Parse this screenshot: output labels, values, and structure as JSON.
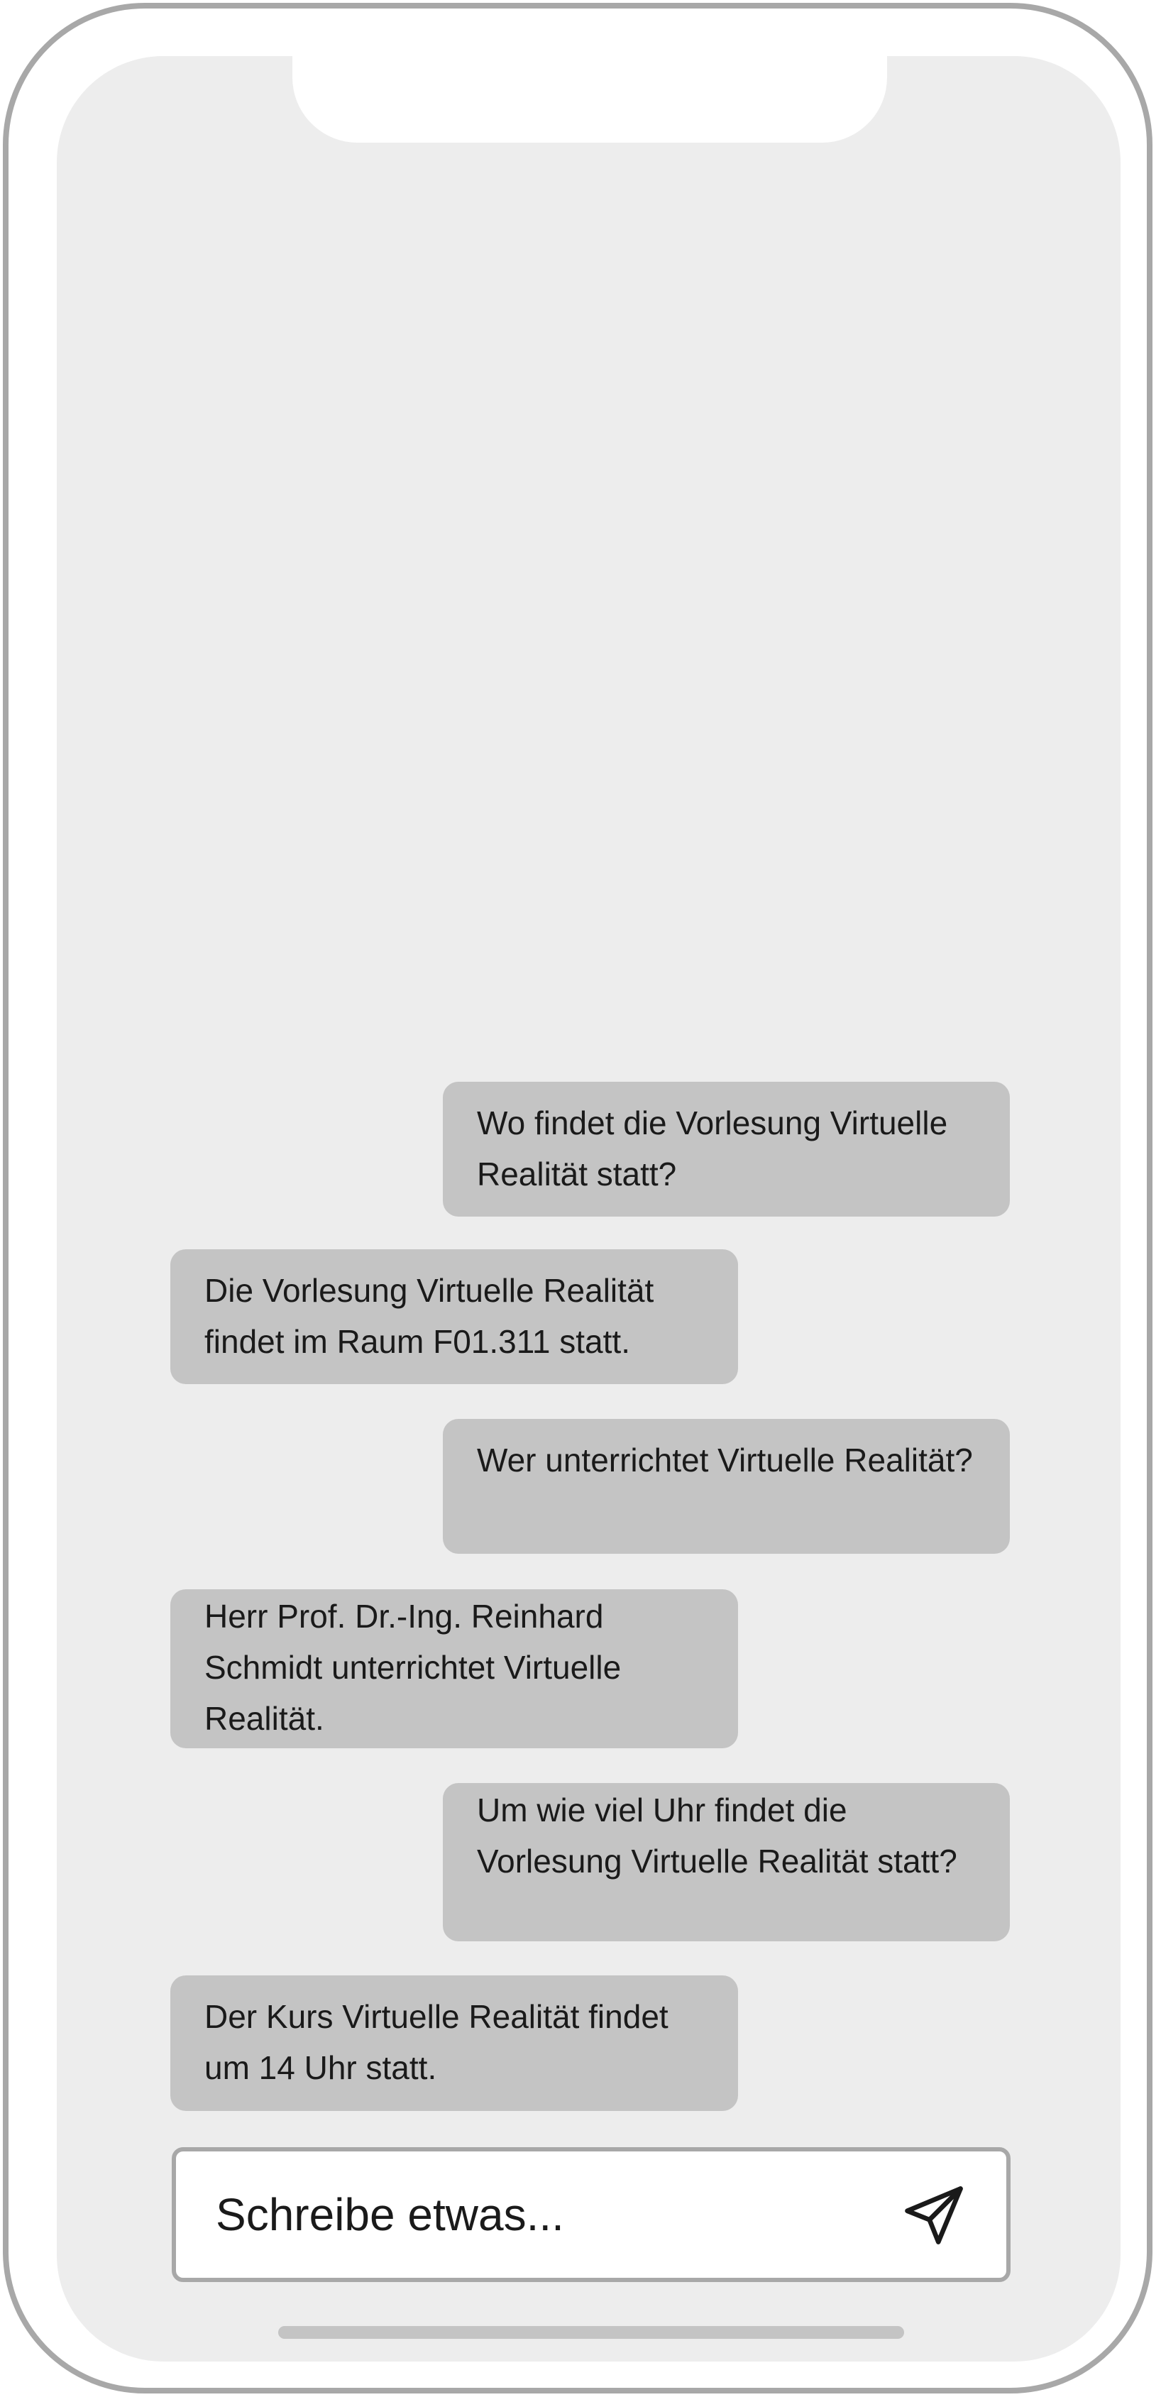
{
  "chat": {
    "messages": [
      {
        "sender": "user",
        "text": "Wo findet die Vorlesung Virtuelle Realität statt?"
      },
      {
        "sender": "bot",
        "text": "Die Vorlesung Virtuelle Realität findet im Raum F01.311 statt."
      },
      {
        "sender": "user",
        "text": "Wer unterrichtet Virtuelle Realität?"
      },
      {
        "sender": "bot",
        "text": "Herr Prof. Dr.-Ing. Reinhard Schmidt unterrichtet Virtuelle Realität."
      },
      {
        "sender": "user",
        "text": "Um wie viel Uhr findet die Vorlesung Virtuelle Realität statt?"
      },
      {
        "sender": "bot",
        "text": "Der Kurs Virtuelle Realität findet um 14 Uhr statt."
      }
    ]
  },
  "composer": {
    "placeholder": "Schreibe etwas...",
    "send_icon": "send-paper-plane-icon"
  },
  "colors": {
    "frame": "#a8a8a8",
    "screen_bg": "#ededed",
    "bubble_bg": "#c4c4c4",
    "text": "#1a1a1a"
  }
}
